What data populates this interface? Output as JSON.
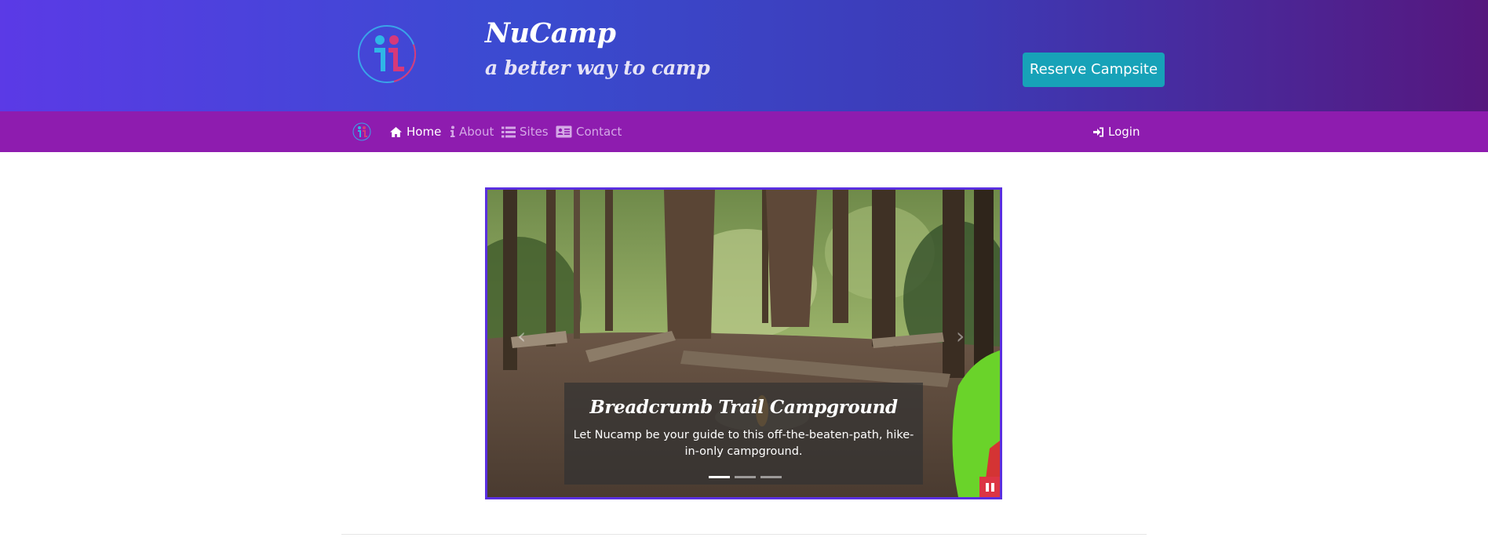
{
  "header": {
    "brand_title": "NuCamp",
    "brand_subtitle": "a better way to camp",
    "reserve_button": "Reserve Campsite",
    "logo_icon": "nucamp-logo-icon"
  },
  "nav": {
    "items": [
      {
        "label": "Home",
        "icon": "home-icon",
        "active": true
      },
      {
        "label": "About",
        "icon": "info-icon",
        "active": false
      },
      {
        "label": "Sites",
        "icon": "list-icon",
        "active": false
      },
      {
        "label": "Contact",
        "icon": "address-card-icon",
        "active": false
      }
    ],
    "login": "Login"
  },
  "carousel": {
    "caption_title": "Breadcrumb Trail Campground",
    "caption_text": "Let Nucamp be your guide to this off-the-beaten-path, hike-in-only campground.",
    "prev_glyph": "‹",
    "next_glyph": "›",
    "slide_count": 3,
    "active_slide": 1
  },
  "colors": {
    "header_gradient": [
      "#5b3ae6",
      "#3a4bd0",
      "#56177e"
    ],
    "navbar": "#8e1caf",
    "reserve_button": "#17a2b8",
    "carousel_border": "#5a2fe0",
    "pause_button": "#dc3545"
  }
}
